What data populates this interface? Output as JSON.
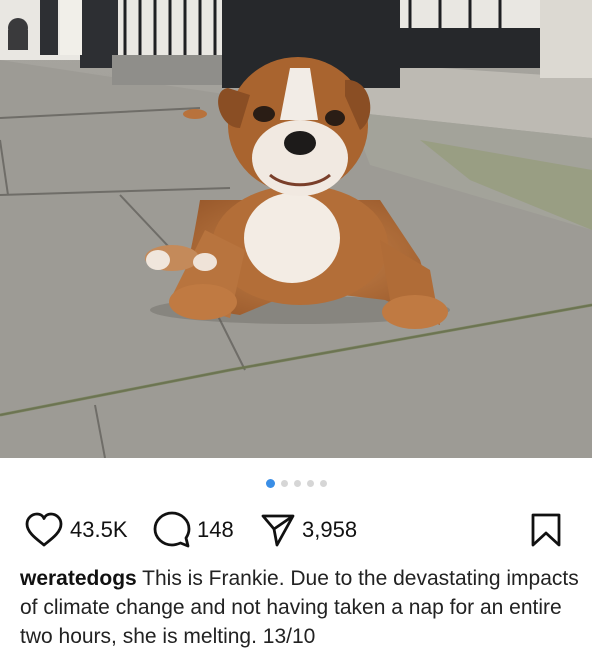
{
  "post": {
    "image_alt": "English bulldog puppy sitting on a pavement",
    "carousel": {
      "total": 5,
      "active_index": 0
    },
    "likes": "43.5K",
    "comments": "148",
    "shares": "3,958",
    "icons": {
      "like": "heart-icon",
      "comment": "comment-bubble-icon",
      "share": "paper-plane-icon",
      "save": "bookmark-icon"
    },
    "username": "weratedogs",
    "caption": "This is Frankie. Due to the devastating impacts of climate change and not having taken a nap for an entire two hours, she is melting. 13/10"
  },
  "colors": {
    "carousel_active": "#3a8ee6",
    "carousel_inactive": "#d6d6d6"
  }
}
